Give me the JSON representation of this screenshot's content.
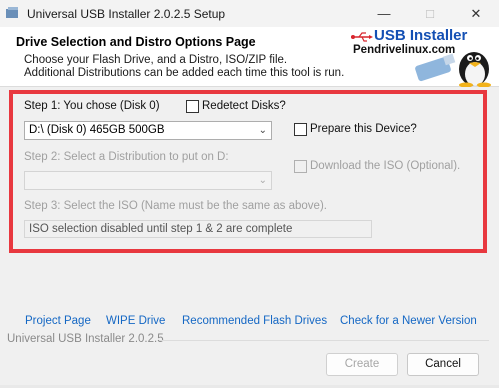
{
  "window": {
    "title": "Universal USB Installer 2.0.2.5 Setup",
    "minimize_icon": "minimize-icon",
    "maximize_icon": "maximize-icon",
    "close_icon": "close-icon"
  },
  "header": {
    "title": "Drive Selection and Distro Options Page",
    "line1": "Choose your Flash Drive, and a Distro, ISO/ZIP file.",
    "line2": "Additional Distributions can be added each time this tool is run.",
    "logo_title": "USB Installer",
    "logo_url": "Pendrivelinux.com",
    "logo_icon": "tux-penguin-usb-logo"
  },
  "step1": {
    "label": "Step 1: You chose (Disk 0)",
    "redetect_label": "Redetect Disks?",
    "drive_value": "D:\\ (Disk 0) 465GB 500GB",
    "prepare_label": "Prepare this Device?"
  },
  "step2": {
    "label": "Step 2: Select a Distribution to put on D:",
    "distro_value": "",
    "download_label": "Download the ISO (Optional)."
  },
  "step3": {
    "label": "Step 3: Select the ISO (Name must be the same as above).",
    "iso_value": "ISO selection disabled until step 1 & 2 are complete"
  },
  "links": {
    "project": "Project Page",
    "wipe": "WIPE Drive",
    "recommended": "Recommended Flash Drives",
    "newer": "Check for a Newer Version"
  },
  "footer": {
    "version": "Universal USB Installer 2.0.2.5",
    "create": "Create",
    "cancel": "Cancel"
  },
  "colors": {
    "highlight": "#e8383f",
    "link": "#1467c4",
    "logo_blue": "#1450b4"
  }
}
